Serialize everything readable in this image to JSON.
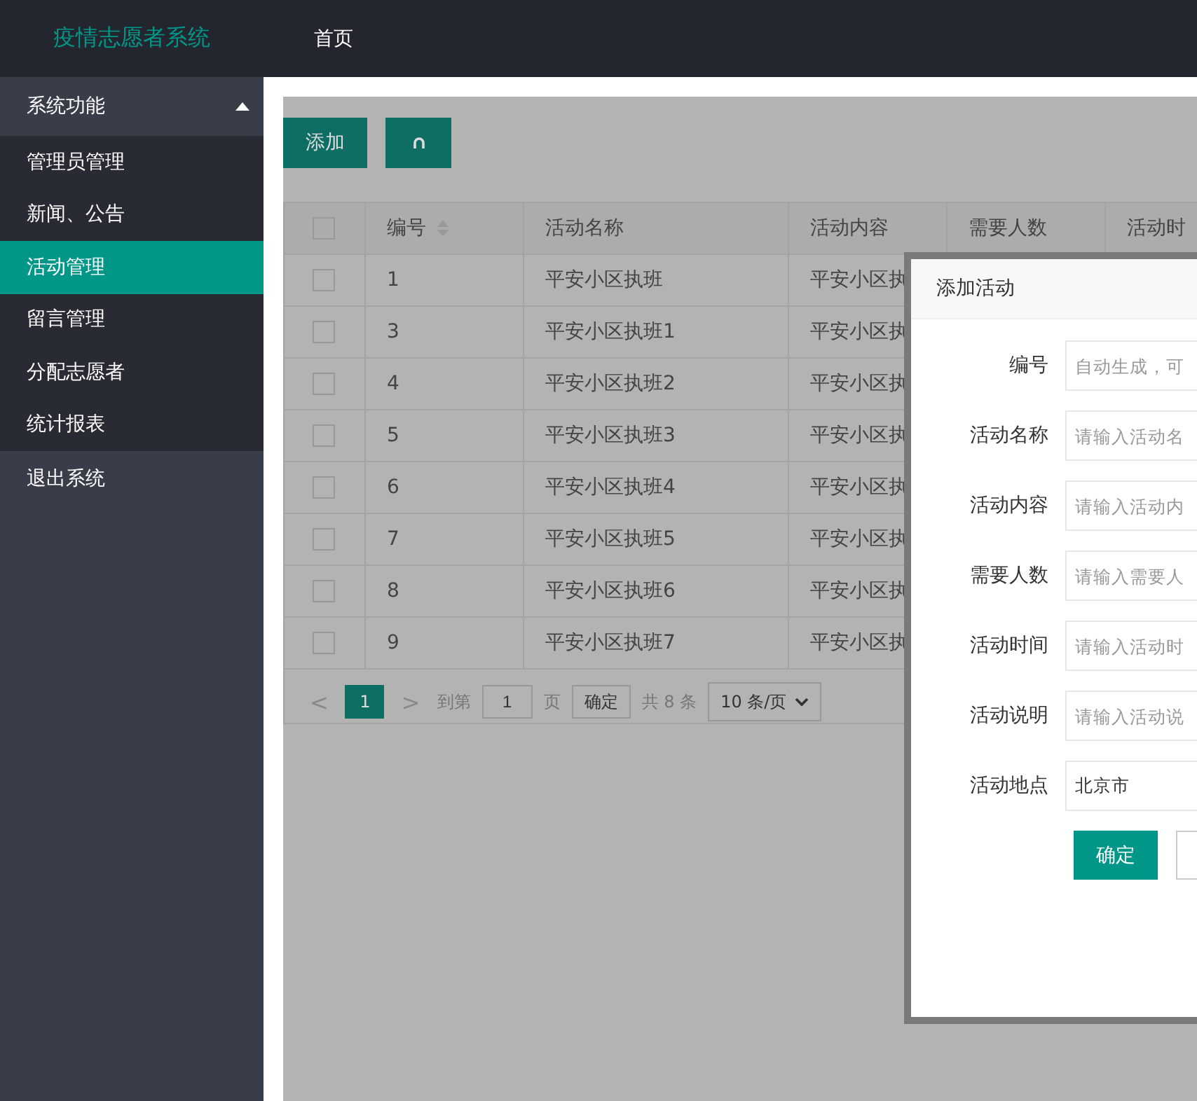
{
  "header": {
    "title": "疫情志愿者系统",
    "nav": [
      {
        "label": "首页"
      }
    ]
  },
  "sidebar": {
    "items": [
      {
        "kind": "group",
        "label": "系统功能",
        "expanded": true,
        "children": [
          {
            "label": "管理员管理",
            "selected": false
          },
          {
            "label": "新闻、公告",
            "selected": false
          },
          {
            "label": "活动管理",
            "selected": true
          },
          {
            "label": "留言管理",
            "selected": false
          },
          {
            "label": "分配志愿者",
            "selected": false
          },
          {
            "label": "统计报表",
            "selected": false
          }
        ]
      },
      {
        "kind": "link",
        "label": "退出系统"
      }
    ]
  },
  "toolbar": {
    "buttons": [
      {
        "kind": "text",
        "label": "添加"
      },
      {
        "kind": "icon"
      }
    ]
  },
  "table": {
    "all_checked": false,
    "columns": [
      {
        "label": "编号",
        "sortable": true
      },
      {
        "label": "活动名称",
        "sortable": false
      },
      {
        "label": "活动内容",
        "sortable": false
      },
      {
        "label": "需要人数",
        "sortable": false
      },
      {
        "label": "活动时",
        "sortable": false
      }
    ],
    "rows": [
      {
        "checked": false,
        "cells": [
          "1",
          "平安小区执班",
          "平安小区执"
        ]
      },
      {
        "checked": false,
        "cells": [
          "3",
          "平安小区执班1",
          "平安小区执"
        ]
      },
      {
        "checked": false,
        "cells": [
          "4",
          "平安小区执班2",
          "平安小区执"
        ]
      },
      {
        "checked": false,
        "cells": [
          "5",
          "平安小区执班3",
          "平安小区执"
        ]
      },
      {
        "checked": false,
        "cells": [
          "6",
          "平安小区执班4",
          "平安小区执"
        ]
      },
      {
        "checked": false,
        "cells": [
          "7",
          "平安小区执班5",
          "平安小区执"
        ]
      },
      {
        "checked": false,
        "cells": [
          "8",
          "平安小区执班6",
          "平安小区执"
        ]
      },
      {
        "checked": false,
        "cells": [
          "9",
          "平安小区执班7",
          "平安小区执"
        ]
      }
    ]
  },
  "pagination": {
    "prev": "<",
    "pages": [
      {
        "label": "1",
        "selected": true
      }
    ],
    "next": ">",
    "goto_label": "到第",
    "goto_value": "1",
    "page_unit": "页",
    "confirm": "确定",
    "total": "共 8 条",
    "page_size": "10 条/页"
  },
  "dialog": {
    "title": "添加活动",
    "fields": [
      {
        "label": "编号",
        "placeholder": "自动生成，可"
      },
      {
        "label": "活动名称",
        "placeholder": "请输入活动名"
      },
      {
        "label": "活动内容",
        "placeholder": "请输入活动内"
      },
      {
        "label": "需要人数",
        "placeholder": "请输入需要人"
      },
      {
        "label": "活动时间",
        "placeholder": "请输入活动时"
      },
      {
        "label": "活动说明",
        "placeholder": "请输入活动说"
      },
      {
        "label": "活动地点",
        "value": "北京市"
      }
    ],
    "buttons": [
      {
        "kind": "primary",
        "label": "确定"
      },
      {
        "kind": "secondary"
      }
    ]
  }
}
